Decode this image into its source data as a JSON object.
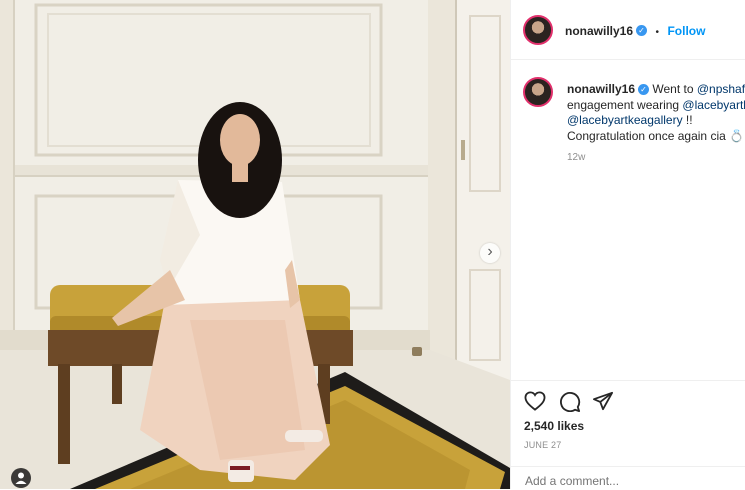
{
  "post": {
    "username": "nonawilly16",
    "follow_label": "Follow",
    "separator": "•",
    "verified_glyph": "✓"
  },
  "caption": {
    "username": "nonawilly16",
    "line1_text": "Went to ",
    "mention1": "@npshafira",
    "line2_text": "engagement wearing ",
    "mention2": "@lacebyartkea",
    "mention3": "@lacebyartkeagallery",
    "line3_text": " !!",
    "line4_text": "Congratulation once again cia",
    "emoji": "💍",
    "time": "12w"
  },
  "engagement": {
    "likes": "2,540 likes",
    "date": "JUNE 27"
  },
  "comment": {
    "placeholder": "Add a comment..."
  },
  "carousel": {
    "next_glyph": "›"
  },
  "icons": [
    "heart-icon",
    "comment-icon",
    "share-icon",
    "next-icon",
    "user-tag-icon",
    "verified-icon"
  ],
  "colors": {
    "link": "#00376b",
    "verified": "#3897f0",
    "follow": "#0095f6",
    "story_ring": "#e1306c",
    "muted": "#8e8e8e",
    "sofa_gold": "#c8a23a"
  }
}
